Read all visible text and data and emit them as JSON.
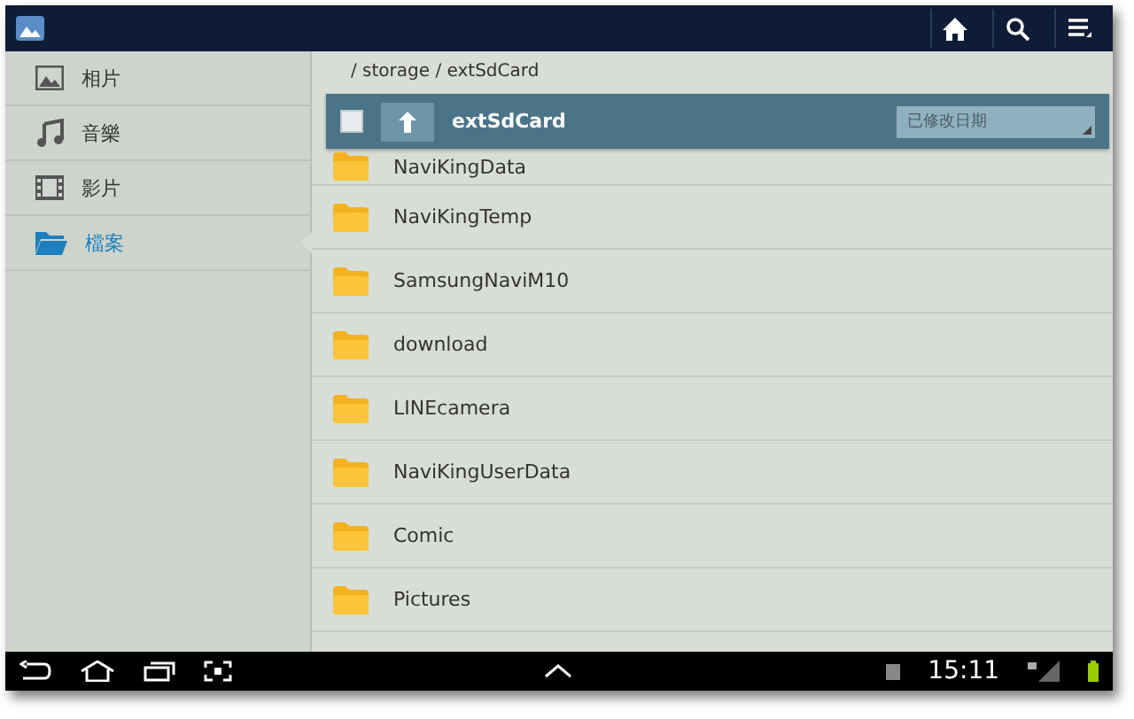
{
  "sidebar": {
    "items": [
      {
        "label": "相片",
        "kind": "photo",
        "selected": false
      },
      {
        "label": "音樂",
        "kind": "music",
        "selected": false
      },
      {
        "label": "影片",
        "kind": "video",
        "selected": false
      },
      {
        "label": "檔案",
        "kind": "folder",
        "selected": true
      }
    ]
  },
  "path": "/ storage / extSdCard",
  "header": {
    "checked": false,
    "title": "extSdCard",
    "sort": "已修改日期"
  },
  "files": [
    "NaviKingData",
    "NaviKingTemp",
    "SamsungNaviM10",
    "download",
    "LINEcamera",
    "NaviKingUserData",
    "Comic",
    "Pictures"
  ],
  "status_bar": {
    "time": "15:11"
  }
}
